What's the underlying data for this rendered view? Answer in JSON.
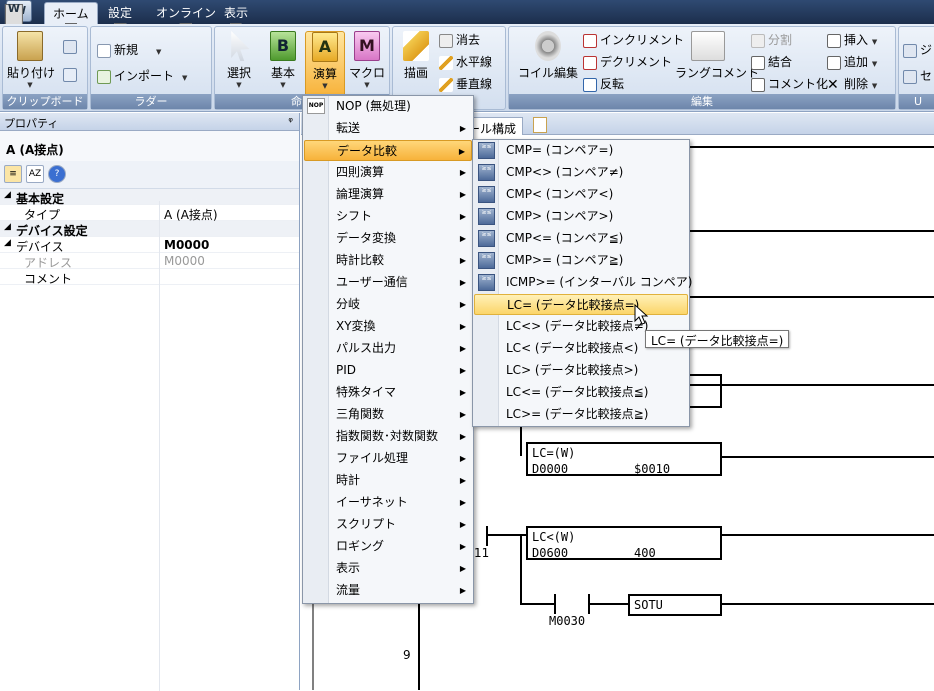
{
  "app": {
    "button_letter": "W",
    "keytip": "W"
  },
  "tabs": [
    {
      "label": "ホーム",
      "keytip": "H",
      "active": true
    },
    {
      "label": "設定",
      "keytip": "C"
    },
    {
      "label": "オンライン",
      "keytip": "O"
    },
    {
      "label": "表示",
      "keytip": "V"
    }
  ],
  "ribbon": {
    "clipboard": {
      "label": "クリップボード",
      "paste": "貼り付け"
    },
    "ladder": {
      "label": "ラダー",
      "new": "新規",
      "import": "インポート"
    },
    "instructions": {
      "label": "命令",
      "select": "選択",
      "basic": "基本",
      "arith": "演算",
      "macro": "マクロ",
      "basic_glyph": "B",
      "arith_glyph": "A",
      "macro_glyph": "M"
    },
    "drawing": {
      "draw": "描画",
      "erase": "消去",
      "hline": "水平線",
      "vline": "垂直線"
    },
    "edit": {
      "label": "編集",
      "coil_edit": "コイル編集",
      "increment": "インクリメント",
      "decrement": "デクリメント",
      "invert": "反転",
      "rung_comment": "ラングコメント",
      "split": "分割",
      "join": "結合",
      "commentize": "コメント化",
      "insert": "挿入",
      "add": "追加",
      "delete": "削除"
    },
    "partial": {
      "item1": "ジ",
      "item2": "セ",
      "label": "U"
    }
  },
  "properties": {
    "title": "プロパティ",
    "pin": "ᵠ",
    "object": "A (A接点)",
    "rows": [
      {
        "type": "cat",
        "key": "基本設定"
      },
      {
        "type": "sub",
        "key": "タイプ",
        "value": "A (A接点)"
      },
      {
        "type": "cat",
        "key": "デバイス設定"
      },
      {
        "type": "sub",
        "key": "デバイス",
        "value": "M0000",
        "bold": true
      },
      {
        "type": "dim",
        "key": "アドレス",
        "value": "M0000"
      },
      {
        "type": "sub",
        "key": "コメント",
        "value": ""
      }
    ]
  },
  "editor": {
    "doc_tab": "ール構成",
    "rungs": {
      "lc_w_1": {
        "title": "LC=(W)",
        "a": "D0000",
        "b": "$0010"
      },
      "lc_w_2": {
        "title": "LC<(W)",
        "a": "D0600",
        "b": "400"
      },
      "coil": "SOTU",
      "contact": "M0030",
      "rung_num_11": "11",
      "rung_num_9": "9"
    }
  },
  "menu_main": {
    "header_icon": "NOP",
    "items": [
      {
        "label": "NOP (無処理)",
        "arrow": false
      },
      {
        "label": "転送",
        "arrow": true
      },
      {
        "label": "データ比較",
        "arrow": true,
        "highlight": true
      },
      {
        "label": "四則演算",
        "arrow": true
      },
      {
        "label": "論理演算",
        "arrow": true
      },
      {
        "label": "シフト",
        "arrow": true
      },
      {
        "label": "データ変換",
        "arrow": true
      },
      {
        "label": "時計比較",
        "arrow": true
      },
      {
        "label": "ユーザー通信",
        "arrow": true
      },
      {
        "label": "分岐",
        "arrow": true
      },
      {
        "label": "XY変換",
        "arrow": true
      },
      {
        "label": "パルス出力",
        "arrow": true
      },
      {
        "label": "PID",
        "arrow": true
      },
      {
        "label": "特殊タイマ",
        "arrow": true
      },
      {
        "label": "三角関数",
        "arrow": true
      },
      {
        "label": "指数関数･対数関数",
        "arrow": true
      },
      {
        "label": "ファイル処理",
        "arrow": true
      },
      {
        "label": "時計",
        "arrow": true
      },
      {
        "label": "イーサネット",
        "arrow": true
      },
      {
        "label": "スクリプト",
        "arrow": true
      },
      {
        "label": "ロギング",
        "arrow": true
      },
      {
        "label": "表示",
        "arrow": true
      },
      {
        "label": "流量",
        "arrow": true
      }
    ]
  },
  "menu_sub": {
    "items": [
      {
        "label": "CMP= (コンペア=)",
        "icon": true
      },
      {
        "label": "CMP<> (コンペア≠)",
        "icon": true
      },
      {
        "label": "CMP< (コンペア<)",
        "icon": true
      },
      {
        "label": "CMP> (コンペア>)",
        "icon": true
      },
      {
        "label": "CMP<= (コンペア≦)",
        "icon": true
      },
      {
        "label": "CMP>= (コンペア≧)",
        "icon": true
      },
      {
        "label": "ICMP>= (インターバル コンペア)",
        "icon": true
      },
      {
        "label": "LC= (データ比較接点=)",
        "highlight": true
      },
      {
        "label": "LC<> (データ比較接点≠)"
      },
      {
        "label": "LC< (データ比較接点<)"
      },
      {
        "label": "LC> (データ比較接点>)"
      },
      {
        "label": "LC<= (データ比較接点≦)"
      },
      {
        "label": "LC>= (データ比較接点≧)"
      }
    ],
    "icon_text": "≥≤"
  },
  "tooltip": "LC= (データ比較接点=)",
  "colors": {
    "highlight": "#f7b23a",
    "ribbon_label": "#6d86ab",
    "titlebar": "#1c2e4c"
  }
}
